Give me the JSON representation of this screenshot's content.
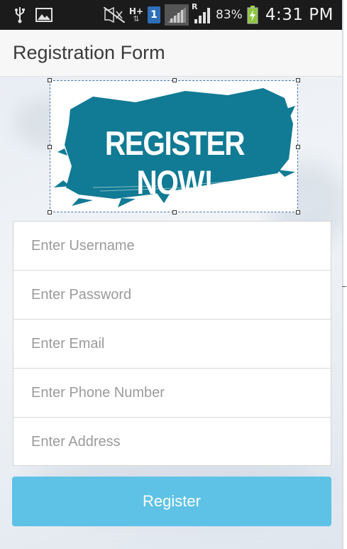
{
  "status_bar": {
    "icons": [
      "usb-icon",
      "image-icon",
      "mute-icon",
      "hplus-data-icon",
      "sim-icon",
      "signal-icon",
      "roaming-signal-icon",
      "battery-charging-icon"
    ],
    "sim_number": "1",
    "network_type": "H+",
    "roaming": "R",
    "battery_percent": "83%",
    "time": "4:31 PM"
  },
  "app": {
    "title": "Registration Form"
  },
  "banner": {
    "text": "REGISTER NOW!",
    "color": "#117a94"
  },
  "form": {
    "fields": [
      {
        "placeholder": "Enter Username",
        "value": ""
      },
      {
        "placeholder": "Enter Password",
        "value": ""
      },
      {
        "placeholder": "Enter Email",
        "value": ""
      },
      {
        "placeholder": "Enter Phone Number",
        "value": ""
      },
      {
        "placeholder": "Enter Address",
        "value": ""
      }
    ],
    "submit_label": "Register"
  },
  "colors": {
    "accent": "#5ec2e6",
    "status_bar": "#1b1b1b"
  }
}
